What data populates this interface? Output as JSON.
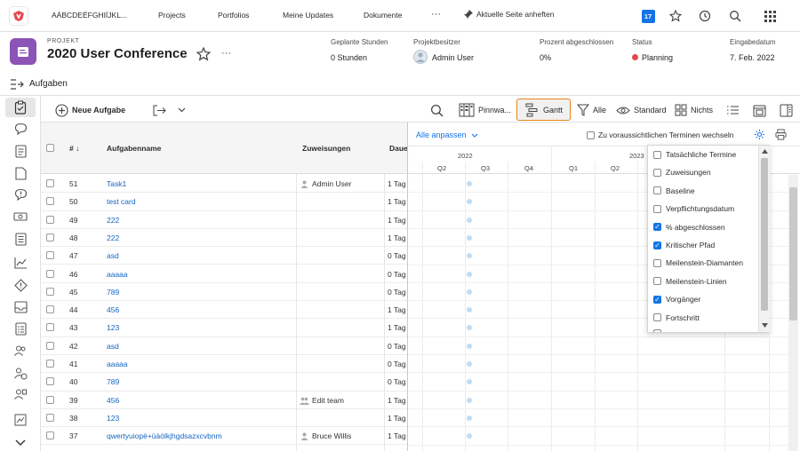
{
  "topbar": {
    "title": "AÁBCDEÉFGHIÍJKL...",
    "nav": [
      "Projects",
      "Portfolios",
      "Meine Updates",
      "Dokumente"
    ],
    "more": "···",
    "pin_label": "Aktuelle Seite anheften",
    "calendar_badge": "17"
  },
  "project": {
    "kind": "PROJEKT",
    "name": "2020 User Conference",
    "more": "···",
    "fields": [
      {
        "label": "Geplante Stunden",
        "value": "0 Stunden"
      },
      {
        "label": "Projektbesitzer",
        "value": "Admin User"
      },
      {
        "label": "Prozent abgeschlossen",
        "value": "0%"
      },
      {
        "label": "Status",
        "value": "Planning"
      },
      {
        "label": "Eingabedatum",
        "value": "7. Feb. 2022"
      }
    ],
    "status_color": "#e34850"
  },
  "tab": {
    "label": "Aufgaben"
  },
  "toolbar": {
    "new_task": "Neue Aufgabe",
    "pinnwand": "Pinnwa...",
    "gantt": "Gantt",
    "filter": "Alle",
    "view": "Standard",
    "grouping": "Nichts"
  },
  "grid": {
    "headers": {
      "num": "# ↓",
      "name": "Aufgabenname",
      "assign": "Zuweisungen",
      "duration": "Dauer"
    },
    "rows": [
      {
        "num": "51",
        "name": "Task1",
        "assign": "Admin User",
        "assign_type": "user",
        "dur": "1 Tag"
      },
      {
        "num": "50",
        "name": "test card",
        "assign": "",
        "assign_type": "",
        "dur": "1 Tag"
      },
      {
        "num": "49",
        "name": "222",
        "assign": "",
        "assign_type": "",
        "dur": "1 Tag"
      },
      {
        "num": "48",
        "name": "222",
        "assign": "",
        "assign_type": "",
        "dur": "1 Tag"
      },
      {
        "num": "47",
        "name": "asd",
        "assign": "",
        "assign_type": "",
        "dur": "0 Tag"
      },
      {
        "num": "46",
        "name": "aaaaa",
        "assign": "",
        "assign_type": "",
        "dur": "0 Tag"
      },
      {
        "num": "45",
        "name": "789",
        "assign": "",
        "assign_type": "",
        "dur": "0 Tag"
      },
      {
        "num": "44",
        "name": "456",
        "assign": "",
        "assign_type": "",
        "dur": "1 Tag"
      },
      {
        "num": "43",
        "name": "123",
        "assign": "",
        "assign_type": "",
        "dur": "1 Tag"
      },
      {
        "num": "42",
        "name": "asd",
        "assign": "",
        "assign_type": "",
        "dur": "0 Tag"
      },
      {
        "num": "41",
        "name": "aaaaa",
        "assign": "",
        "assign_type": "",
        "dur": "0 Tag"
      },
      {
        "num": "40",
        "name": "789",
        "assign": "",
        "assign_type": "",
        "dur": "0 Tag"
      },
      {
        "num": "39",
        "name": "456",
        "assign": "Edit team",
        "assign_type": "team",
        "dur": "1 Tag"
      },
      {
        "num": "38",
        "name": "123",
        "assign": "",
        "assign_type": "",
        "dur": "1 Tag"
      },
      {
        "num": "37",
        "name": "qwertyuiopè+ùàòlkjhgdsazxcvbnm",
        "assign": "Bruce Willis",
        "assign_type": "user",
        "dur": "1 Tag"
      }
    ]
  },
  "gantt": {
    "fit": "Alle anpassen",
    "expected_toggle": "Zu voraussichtlichen Terminen wechseln",
    "years": [
      "2022",
      "2023"
    ],
    "quarters": [
      "Q2",
      "Q3",
      "Q4",
      "Q1",
      "Q2"
    ],
    "options": [
      {
        "label": "Tatsächliche Termine",
        "checked": false
      },
      {
        "label": "Zuweisungen",
        "checked": false
      },
      {
        "label": "Baseline",
        "checked": false
      },
      {
        "label": "Verpflichtungsdatum",
        "checked": false
      },
      {
        "label": "% abgeschlossen",
        "checked": true
      },
      {
        "label": "Kritischer Pfad",
        "checked": true
      },
      {
        "label": "Meilenstein-Diamanten",
        "checked": false
      },
      {
        "label": "Meilenstein-Linien",
        "checked": false
      },
      {
        "label": "Vorgänger",
        "checked": true
      },
      {
        "label": "Fortschritt",
        "checked": false
      }
    ]
  }
}
